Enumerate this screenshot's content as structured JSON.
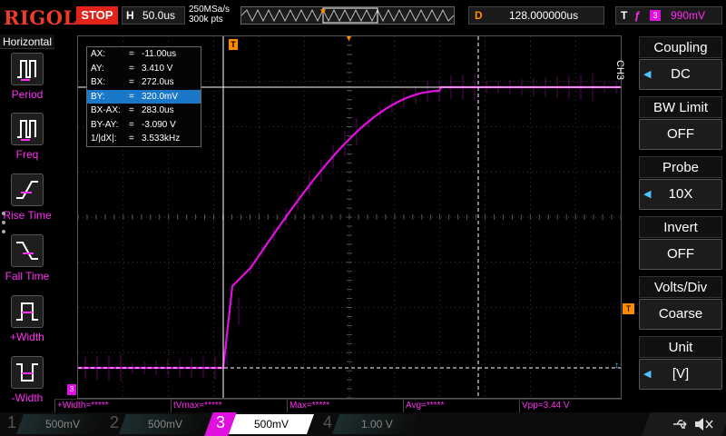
{
  "header": {
    "brand": "RIGOL",
    "run_state": "STOP",
    "timebase_letter": "H",
    "timebase_value": "50.0us",
    "sample_rate": "250MSa/s",
    "memory_depth": "300k pts",
    "delay_letter": "D",
    "delay_value": "128.000000us",
    "trigger_letter": "T",
    "trigger_source": "3",
    "trigger_level": "990mV"
  },
  "left_panel": {
    "title": "Horizontal",
    "buttons": [
      {
        "label": "Period",
        "icon": "period-icon"
      },
      {
        "label": "Freq",
        "icon": "frequency-icon"
      },
      {
        "label": "Rise Time",
        "icon": "rise-time-icon"
      },
      {
        "label": "Fall Time",
        "icon": "fall-time-icon"
      },
      {
        "label": "+Width",
        "icon": "positive-width-icon"
      },
      {
        "label": "-Width",
        "icon": "negative-width-icon"
      }
    ]
  },
  "cursors": [
    {
      "label": "AX:",
      "eq": "=",
      "value": "-11.00us"
    },
    {
      "label": "AY:",
      "eq": "=",
      "value": "3.410 V"
    },
    {
      "label": "BX:",
      "eq": "=",
      "value": "272.0us"
    },
    {
      "label": "BY:",
      "eq": "=",
      "value": "320.0mV"
    },
    {
      "label": "BX-AX:",
      "eq": "=",
      "value": "283.0us"
    },
    {
      "label": "BY-AY:",
      "eq": "=",
      "value": "-3.090 V"
    },
    {
      "label": "1/|dX|:",
      "eq": "=",
      "value": "3.533kHz"
    }
  ],
  "screen": {
    "trigger_marker": "T",
    "channel_marker": "3",
    "level_marker": "T",
    "side_channel_tag": "CH3"
  },
  "measurements": [
    {
      "text": "+Width=*****"
    },
    {
      "text": "tVmax=*****"
    },
    {
      "text": "Max=*****"
    },
    {
      "text": "Avg=*****"
    },
    {
      "text": "Vpp=3.44 V"
    }
  ],
  "right_panel": {
    "items": [
      {
        "title": "Coupling",
        "value": "DC"
      },
      {
        "title": "BW Limit",
        "value": "OFF"
      },
      {
        "title": "Probe",
        "value": "10X"
      },
      {
        "title": "Invert",
        "value": "OFF"
      },
      {
        "title": "Volts/Div",
        "value": "Coarse"
      },
      {
        "title": "Unit",
        "value": "[V]"
      }
    ]
  },
  "channels": [
    {
      "num": "1",
      "scale": "500mV"
    },
    {
      "num": "2",
      "scale": "500mV"
    },
    {
      "num": "3",
      "scale": "500mV"
    },
    {
      "num": "4",
      "scale": "1.00 V"
    }
  ],
  "colors": {
    "channel3": "#e010e0",
    "trigger": "#ff8a00",
    "cursor": "#ffffff",
    "grid": "#3a3a3a",
    "selected_cursor_row": "#1b78c8"
  }
}
